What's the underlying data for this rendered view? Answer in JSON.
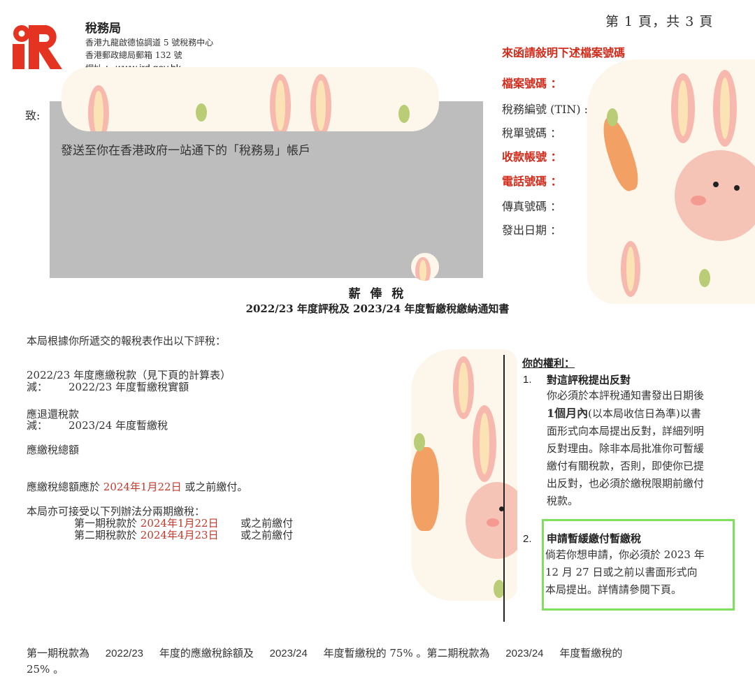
{
  "header": {
    "department": "稅務局",
    "address_line1": "香港九龍啟德協調道 5 號稅務中心",
    "address_line2": "香港郵政總局郵箱 132 號",
    "website_label": "網址 ：",
    "website": "www.ird.gov.hk",
    "page_number": "第 1 頁，共 3 頁"
  },
  "reference_panel": {
    "instruction": "來函請敍明下述檔案號碼",
    "file_number": "檔案號碼 ：",
    "tin": "稅務編號 (TIN) :",
    "tax_return_no": "稅單號碼 ：",
    "receipt_account": "收款帳號 ：",
    "phone": "電話號碼 ：",
    "fax": "傳真號碼 ：",
    "issue_date": "發出日期 ："
  },
  "recipient": {
    "to_label": "致:",
    "delivery_note": "發送至你在香港政府一站通下的「稅務易」帳戶"
  },
  "notice_title": {
    "line1": "薪 俸 稅",
    "line2": "2022/23  年度評稅及  2023/24  年度暫繳稅繳納通知書"
  },
  "assessment": {
    "intro": "本局根據你所遞交的報稅表作出以下評稅：",
    "tax_payable": "2022/23  年度應繳稅款（見下頁的計算表）",
    "less_label": "減：",
    "less_provisional_paid": "2022/23  年度暫繳稅實額",
    "refund": "應退還稅款",
    "less_provisional": "2023/24  年度暫繳稅",
    "total_payable": "應繳稅總額",
    "due_prefix": "應繳稅總額應於",
    "due_date": "2024年1月22日",
    "due_suffix": "或之前繳付。",
    "installment_intro": "本局亦可接受以下列辦法分兩期繳稅：",
    "first_installment_prefix": "第一期稅款於",
    "first_installment_date": "2024年1月22日",
    "first_installment_suffix": "或之前繳付",
    "second_installment_prefix": "第二期稅款於",
    "second_installment_date": "2024年4月23日",
    "second_installment_suffix": "或之前繳付"
  },
  "rights": {
    "title": "你的權利：",
    "item1_number": "1.",
    "item1_title": "對這評稅提出反對",
    "item1_line1": "你必須於本評稅通知書發出日期後",
    "item1_bold": "1個月內",
    "item1_line2_rest": "(以本局收信日為準)以書",
    "item1_line3": "面形式向本局提出反對，詳細列明",
    "item1_line4": "反對理由。除非本局批准你可暫緩",
    "item1_line5": "繳付有關稅款，否則，即使你已提",
    "item1_line6": "出反對，也必須於繳稅限期前繳付",
    "item1_line7": "稅款。",
    "item2_number": "2.",
    "item2_title": "申請暫緩繳付暫繳稅",
    "item2_line1": "倘若你想申請，你必須於 2023 年",
    "item2_line2": " 12 月 27 日或之前以書面形式向",
    "item2_line3": "本局提出。詳情請參閱下頁。"
  },
  "footer": {
    "p1": "第一期稅款為",
    "p2": "2022/23",
    "p3": "年度的應繳稅餘額及",
    "p4": "2023/24",
    "p5": "年度暫繳稅的  75% 。第二期稅款為",
    "p6": "2023/24",
    "p7": "年度暫繳稅的",
    "p8": "25% 。"
  },
  "colors": {
    "accent_red": "#d42a1a",
    "highlight_green": "#7ee05c",
    "redaction_gray": "#bdbdbd"
  }
}
